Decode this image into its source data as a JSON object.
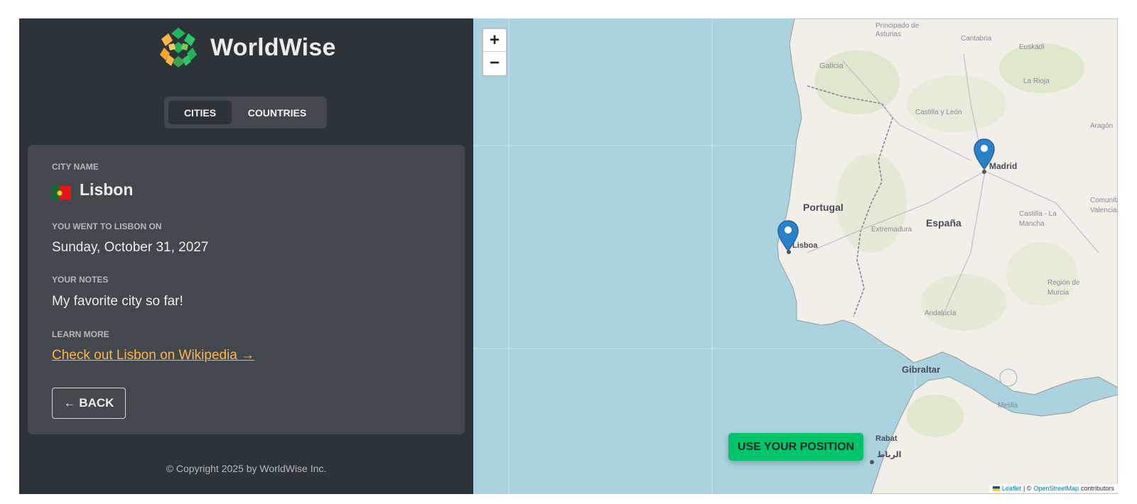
{
  "brand": {
    "name": "WorldWise"
  },
  "tabs": [
    {
      "label": "Cities",
      "active": true
    },
    {
      "label": "Countries",
      "active": false
    }
  ],
  "city": {
    "name_label": "City name",
    "name": "Lisbon",
    "flag": "portugal-flag",
    "visit_label": "You went to Lisbon on",
    "visit_date": "Sunday, October 31, 2027",
    "notes_label": "Your notes",
    "notes": "My favorite city so far!",
    "learn_label": "Learn more",
    "wiki_link": "Check out Lisbon on Wikipedia →"
  },
  "back_button": "← BACK",
  "footer": {
    "copyright": "© Copyright 2025 by WorldWise Inc."
  },
  "map": {
    "zoom_in": "+",
    "zoom_out": "−",
    "labels": {
      "portugal": "Portugal",
      "espana": "España",
      "madrid": "Madrid",
      "lisboa": "Lisboa",
      "gibraltar": "Gibraltar",
      "galicia": "Galicia",
      "asturias": "Principado de Asturias",
      "cantabria": "Cantabria",
      "euskadi": "Euskadi",
      "rioja": "La Rioja",
      "aragon": "Aragón",
      "castilla_leon": "Castilla y León",
      "castilla_mancha": "Castilla - La Mancha",
      "valencia": "Comunitat Valenciana",
      "extremadura": "Extremadura",
      "andalucia": "Andalucía",
      "murcia": "Región de Murcia",
      "melilla": "Melilla",
      "rabat": "Rabat",
      "rabat_ar": "الرباط"
    },
    "use_position": "Use your position",
    "attribution": {
      "leaflet": "Leaflet",
      "separator": "| ©",
      "osm": "OpenStreetMap",
      "suffix": "contributors"
    },
    "colors": {
      "water": "#aad3df",
      "land": "#f2efe9",
      "marker": "#2a81cb",
      "button": "#00c46a"
    }
  }
}
